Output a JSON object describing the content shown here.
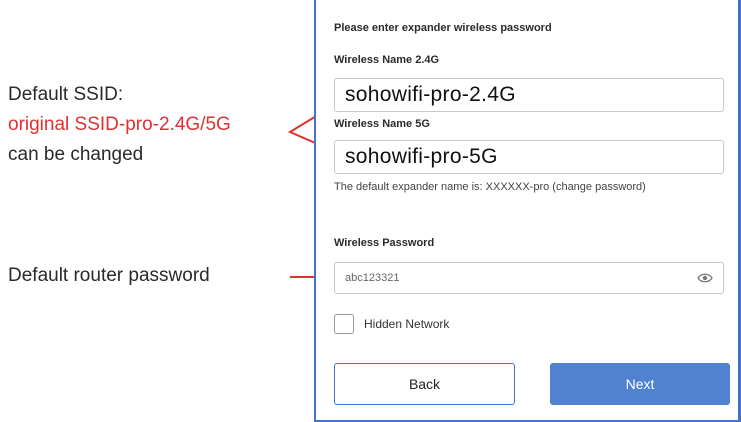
{
  "annotations": {
    "ssid_line1": "Default SSID:",
    "ssid_line2": "original SSID-pro-2.4G/5G",
    "ssid_line3": "can be changed",
    "password": "Default router password"
  },
  "form": {
    "heading": "Please enter expander wireless password",
    "name24_label": "Wireless Name 2.4G",
    "name24_value": "sohowifi-pro-2.4G",
    "name5_label": "Wireless Name 5G",
    "name5_value": "sohowifi-pro-5G",
    "note": "The default expander name is: XXXXXX-pro (change password)",
    "password_label": "Wireless Password",
    "password_value": "abc123321",
    "hidden_label": "Hidden Network",
    "hidden_checked": false,
    "back_label": "Back",
    "next_label": "Next"
  },
  "icons": {
    "password_toggle": "eye-icon",
    "checkbox": "checkbox-unchecked"
  },
  "colors": {
    "accent_blue": "#3f74c6",
    "button_blue": "#4f82d0",
    "annotation_red": "#e0312f"
  }
}
